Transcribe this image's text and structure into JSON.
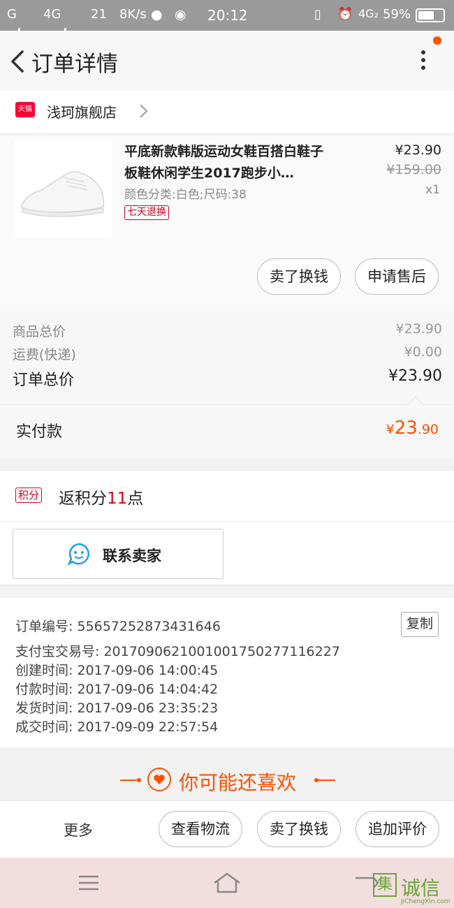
{
  "status_bar": {
    "carrier_left": "G",
    "network_1": "4G",
    "speed_num": "21",
    "speed": "8K/s",
    "time": "20:12",
    "network_2": "4G₂",
    "battery": "59%"
  },
  "header": {
    "title": "订单详情"
  },
  "shop": {
    "badge": "天猫",
    "name": "浅珂旗舰店"
  },
  "product": {
    "title": "平底新款韩版运动女鞋百搭白鞋子板鞋休闲学生2017跑步小…",
    "sku": "颜色分类:白色;尺码:38",
    "return_badge": "七天退换",
    "price": "¥23.90",
    "original_price": "¥159.00",
    "quantity": "x1",
    "buttons": {
      "sell_label": "卖了换钱",
      "after_sale_label": "申请售后"
    }
  },
  "summary": {
    "goods_total_label": "商品总价",
    "goods_total_value": "¥23.90",
    "shipping_label": "运费(快递)",
    "shipping_value": "¥0.00",
    "order_total_label": "订单总价",
    "order_total_value": "¥23.90"
  },
  "payment": {
    "label": "实付款",
    "currency": "¥",
    "integer": "23",
    "decimal": ".90"
  },
  "points": {
    "badge": "积分",
    "text_prefix": "返积分",
    "amount": "11",
    "text_suffix": "点"
  },
  "contact": {
    "label": "联系卖家"
  },
  "order_info": {
    "order_no": "订单编号: 55657252873431646",
    "alipay_no": "支付宝交易号: 2017090621001001750277116227",
    "created": "创建时间: 2017-09-06  14:00:45",
    "paid": "付款时间: 2017-09-06  14:04:42",
    "shipped": "发货时间: 2017-09-06  23:35:23",
    "completed": "成交时间: 2017-09-09  22:57:54",
    "copy_label": "复制"
  },
  "recommend": {
    "label": "你可能还喜欢"
  },
  "action_bar": {
    "more_label": "更多",
    "logistics_label": "查看物流",
    "sell_label": "卖了换钱",
    "review_label": "追加评价"
  },
  "watermark": {
    "glyph": "集",
    "text": "诚信",
    "sub": "JiChengXin.com"
  },
  "colors": {
    "accent": "#ff5000",
    "tmall_red": "#d4001f",
    "navbar_bg": "#f2dede"
  }
}
